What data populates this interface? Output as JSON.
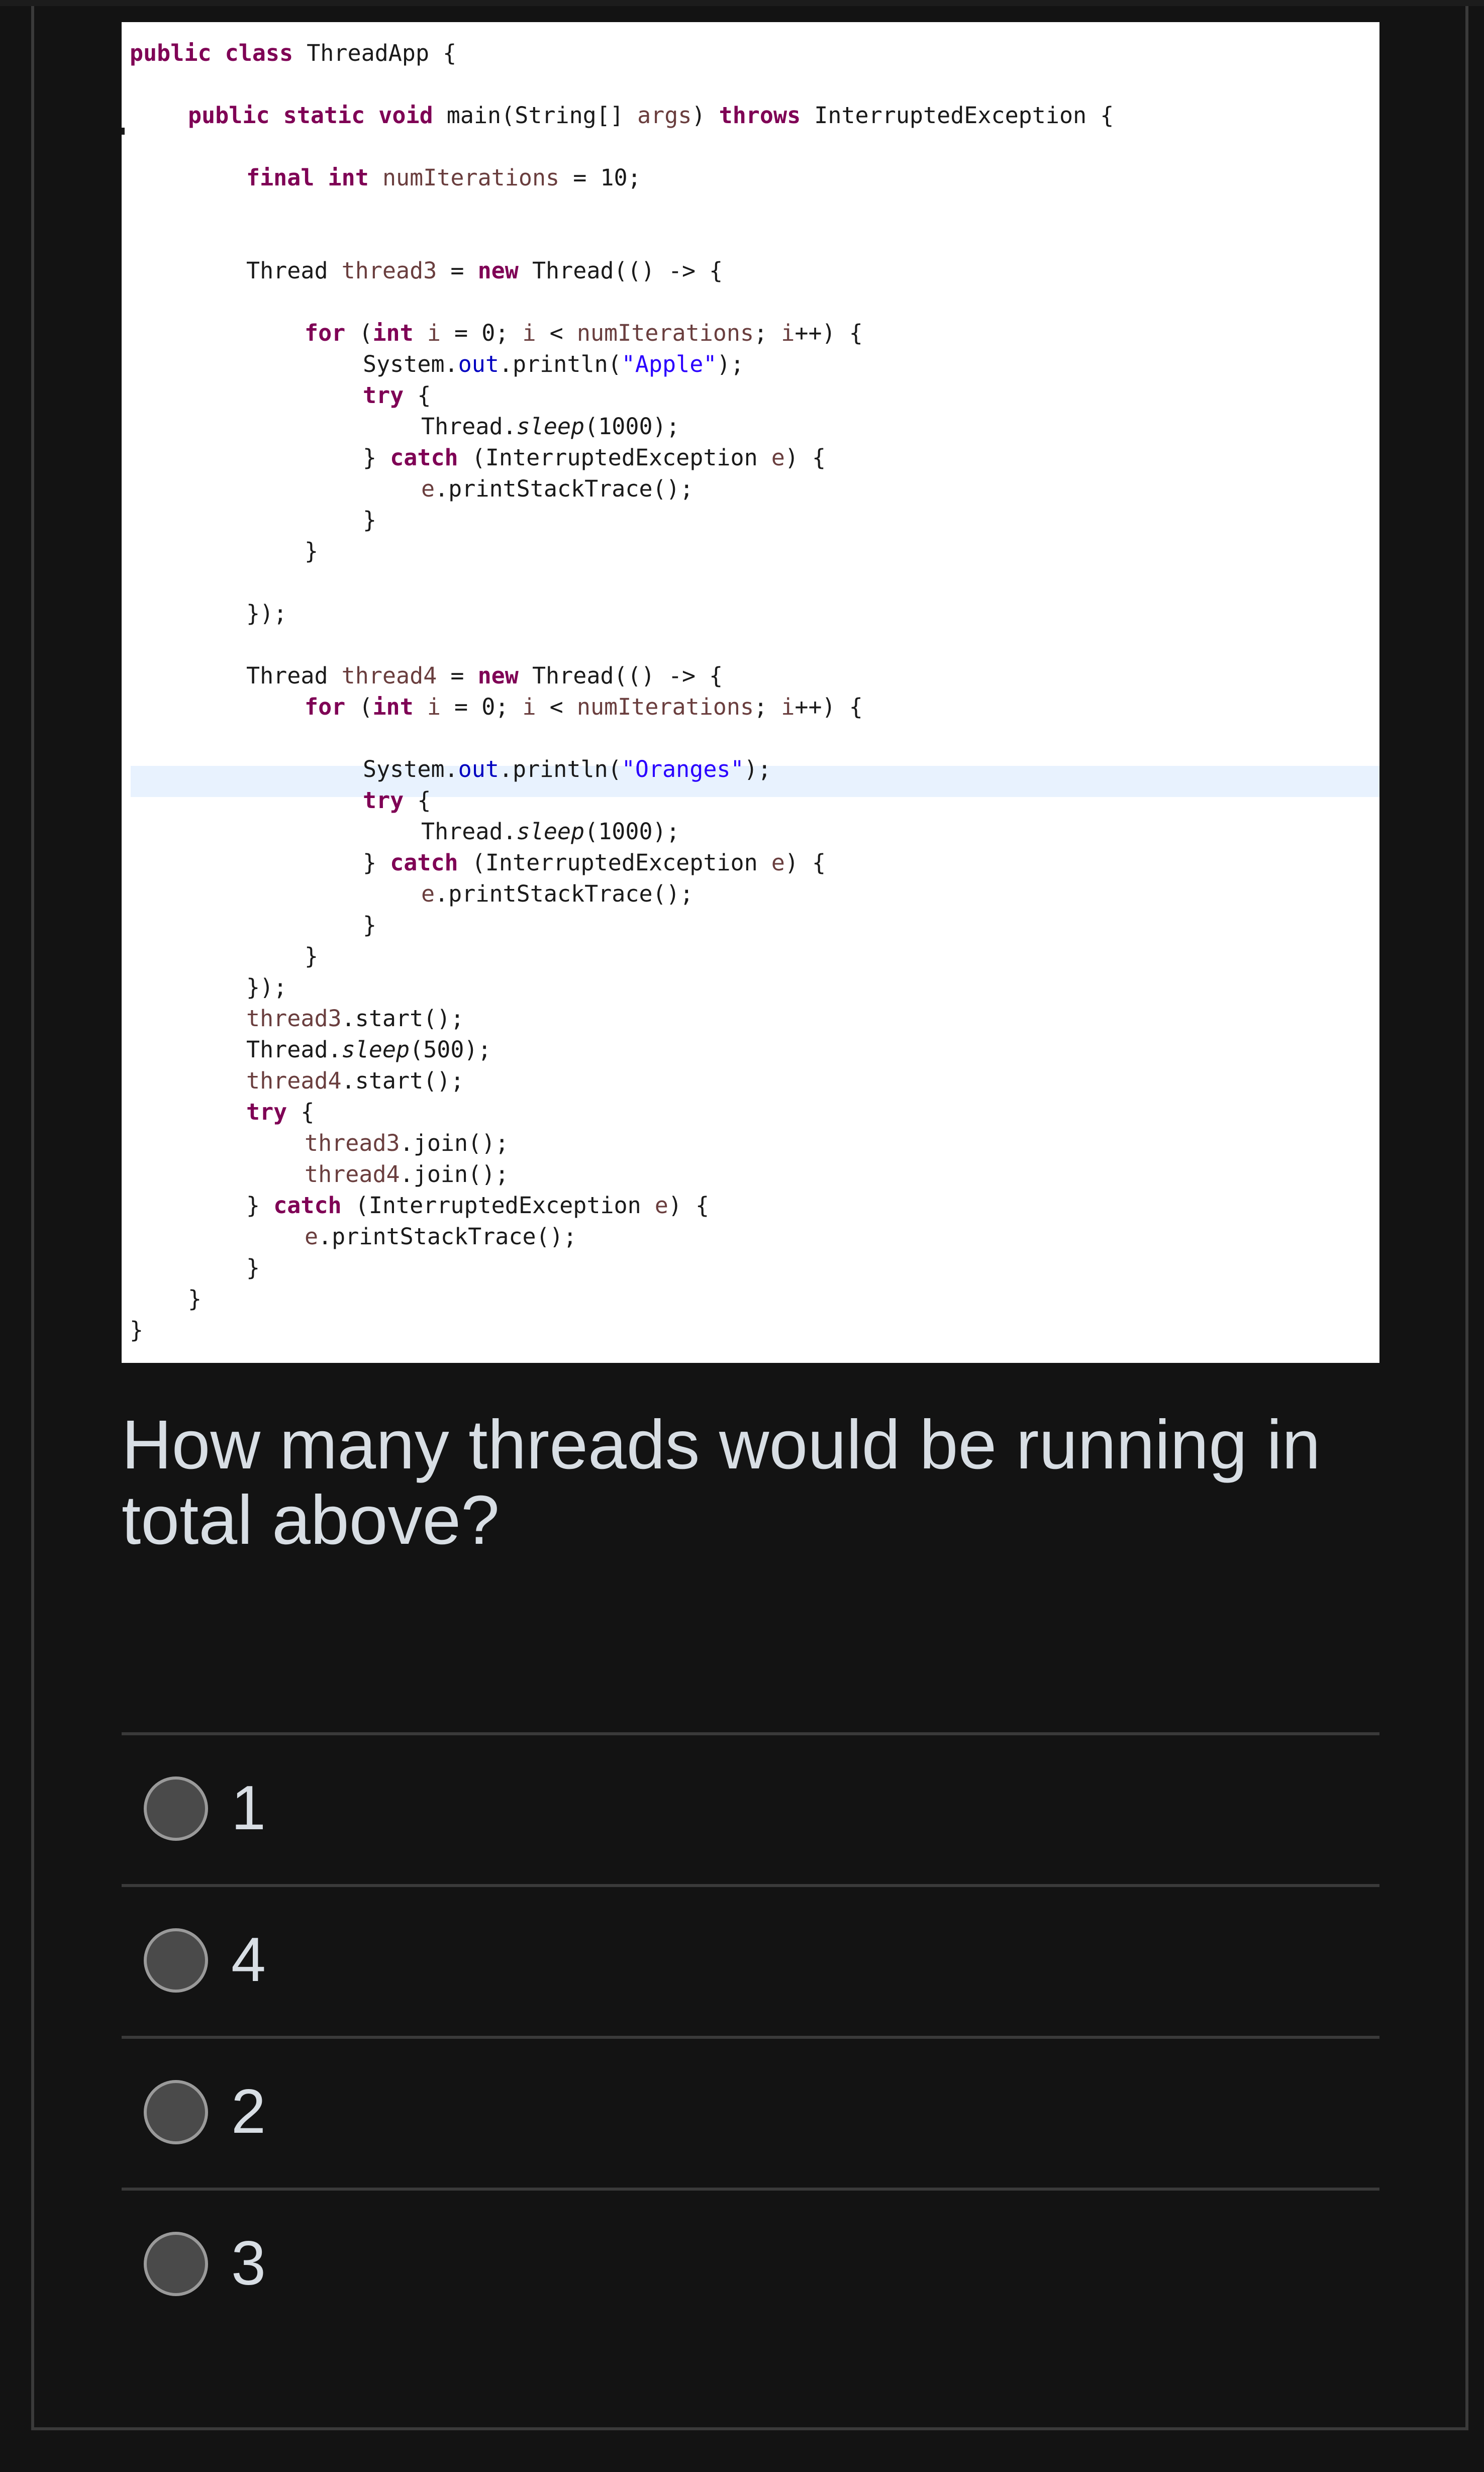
{
  "code": {
    "lines": [
      [
        {
          "t": "public class",
          "c": "kw"
        },
        {
          "t": " ThreadApp {",
          "c": ""
        }
      ],
      [
        {
          "t": "public static void",
          "c": "kw"
        },
        {
          "t": " main(String[] ",
          "c": ""
        },
        {
          "t": "args",
          "c": "vr"
        },
        {
          "t": ") ",
          "c": ""
        },
        {
          "t": "throws",
          "c": "kw"
        },
        {
          "t": " InterruptedException {",
          "c": ""
        }
      ],
      [
        {
          "t": "final int",
          "c": "kw"
        },
        {
          "t": " ",
          "c": ""
        },
        {
          "t": "numIterations",
          "c": "vr"
        },
        {
          "t": " = 10;",
          "c": ""
        }
      ],
      [
        {
          "t": "Thread ",
          "c": ""
        },
        {
          "t": "thread3",
          "c": "vr"
        },
        {
          "t": " = ",
          "c": ""
        },
        {
          "t": "new",
          "c": "kw"
        },
        {
          "t": " Thread(() -> {",
          "c": ""
        }
      ],
      [
        {
          "t": "for",
          "c": "kw"
        },
        {
          "t": " (",
          "c": ""
        },
        {
          "t": "int",
          "c": "kw"
        },
        {
          "t": " ",
          "c": ""
        },
        {
          "t": "i",
          "c": "vr"
        },
        {
          "t": " = 0; ",
          "c": ""
        },
        {
          "t": "i",
          "c": "vr"
        },
        {
          "t": " < ",
          "c": ""
        },
        {
          "t": "numIterations",
          "c": "vr"
        },
        {
          "t": "; ",
          "c": ""
        },
        {
          "t": "i",
          "c": "vr"
        },
        {
          "t": "++) {",
          "c": ""
        }
      ],
      [
        {
          "t": "System.",
          "c": ""
        },
        {
          "t": "out",
          "c": "fd"
        },
        {
          "t": ".println(",
          "c": ""
        },
        {
          "t": "\"Apple\"",
          "c": "st"
        },
        {
          "t": ");",
          "c": ""
        }
      ],
      [
        {
          "t": "try",
          "c": "kw"
        },
        {
          "t": " {",
          "c": ""
        }
      ],
      [
        {
          "t": "Thread.",
          "c": ""
        },
        {
          "t": "sleep",
          "c": "it"
        },
        {
          "t": "(1000);",
          "c": ""
        }
      ],
      [
        {
          "t": "} ",
          "c": ""
        },
        {
          "t": "catch",
          "c": "kw"
        },
        {
          "t": " (InterruptedException ",
          "c": ""
        },
        {
          "t": "e",
          "c": "vr"
        },
        {
          "t": ") {",
          "c": ""
        }
      ],
      [
        {
          "t": "e",
          "c": "vr"
        },
        {
          "t": ".printStackTrace();",
          "c": ""
        }
      ],
      [
        {
          "t": "}",
          "c": ""
        }
      ],
      [
        {
          "t": "}",
          "c": ""
        }
      ],
      [
        {
          "t": "});",
          "c": ""
        }
      ],
      [
        {
          "t": "Thread ",
          "c": ""
        },
        {
          "t": "thread4",
          "c": "vr"
        },
        {
          "t": " = ",
          "c": ""
        },
        {
          "t": "new",
          "c": "kw"
        },
        {
          "t": " Thread(() -> {",
          "c": ""
        }
      ],
      [
        {
          "t": "for",
          "c": "kw"
        },
        {
          "t": " (",
          "c": ""
        },
        {
          "t": "int",
          "c": "kw"
        },
        {
          "t": " ",
          "c": ""
        },
        {
          "t": "i",
          "c": "vr"
        },
        {
          "t": " = 0; ",
          "c": ""
        },
        {
          "t": "i",
          "c": "vr"
        },
        {
          "t": " < ",
          "c": ""
        },
        {
          "t": "numIterations",
          "c": "vr"
        },
        {
          "t": "; ",
          "c": ""
        },
        {
          "t": "i",
          "c": "vr"
        },
        {
          "t": "++) {",
          "c": ""
        }
      ],
      [
        {
          "t": "System.",
          "c": ""
        },
        {
          "t": "out",
          "c": "fd"
        },
        {
          "t": ".println(",
          "c": ""
        },
        {
          "t": "\"Oranges\"",
          "c": "st"
        },
        {
          "t": ");",
          "c": ""
        }
      ],
      [
        {
          "t": "try",
          "c": "kw"
        },
        {
          "t": " {",
          "c": ""
        }
      ],
      [
        {
          "t": "Thread.",
          "c": ""
        },
        {
          "t": "sleep",
          "c": "it"
        },
        {
          "t": "(1000);",
          "c": ""
        }
      ],
      [
        {
          "t": "} ",
          "c": ""
        },
        {
          "t": "catch",
          "c": "kw"
        },
        {
          "t": " (InterruptedException ",
          "c": ""
        },
        {
          "t": "e",
          "c": "vr"
        },
        {
          "t": ") {",
          "c": ""
        }
      ],
      [
        {
          "t": "e",
          "c": "vr"
        },
        {
          "t": ".printStackTrace();",
          "c": ""
        }
      ],
      [
        {
          "t": "}",
          "c": ""
        }
      ],
      [
        {
          "t": "}",
          "c": ""
        }
      ],
      [
        {
          "t": "});",
          "c": ""
        }
      ],
      [
        {
          "t": "thread3",
          "c": "vr"
        },
        {
          "t": ".start();",
          "c": ""
        }
      ],
      [
        {
          "t": "Thread.",
          "c": ""
        },
        {
          "t": "sleep",
          "c": "it"
        },
        {
          "t": "(500);",
          "c": ""
        }
      ],
      [
        {
          "t": "thread4",
          "c": "vr"
        },
        {
          "t": ".start();",
          "c": ""
        }
      ],
      [
        {
          "t": "try",
          "c": "kw"
        },
        {
          "t": " {",
          "c": ""
        }
      ],
      [
        {
          "t": "thread3",
          "c": "vr"
        },
        {
          "t": ".join();",
          "c": ""
        }
      ],
      [
        {
          "t": "thread4",
          "c": "vr"
        },
        {
          "t": ".join();",
          "c": ""
        }
      ],
      [
        {
          "t": "} ",
          "c": ""
        },
        {
          "t": "catch",
          "c": "kw"
        },
        {
          "t": " (InterruptedException ",
          "c": ""
        },
        {
          "t": "e",
          "c": "vr"
        },
        {
          "t": ") {",
          "c": ""
        }
      ],
      [
        {
          "t": "e",
          "c": "vr"
        },
        {
          "t": ".printStackTrace();",
          "c": ""
        }
      ],
      [
        {
          "t": "}",
          "c": ""
        }
      ],
      [
        {
          "t": "}",
          "c": ""
        }
      ],
      [
        {
          "t": "}",
          "c": ""
        }
      ]
    ],
    "highlighted_line_color": "#e8f2fe"
  },
  "question": {
    "line1": "How many threads would be running in",
    "line2": "total above?"
  },
  "options": [
    {
      "label": "1"
    },
    {
      "label": "4"
    },
    {
      "label": "2"
    },
    {
      "label": "3"
    }
  ],
  "colors": {
    "background": "#131313",
    "text": "#d8dee4",
    "divider": "#3a3a3a",
    "radio_fill": "#4a4a4a",
    "keyword": "#7f0055",
    "variable": "#6a3e3e",
    "field": "#0000c0",
    "string": "#2a00ff"
  }
}
